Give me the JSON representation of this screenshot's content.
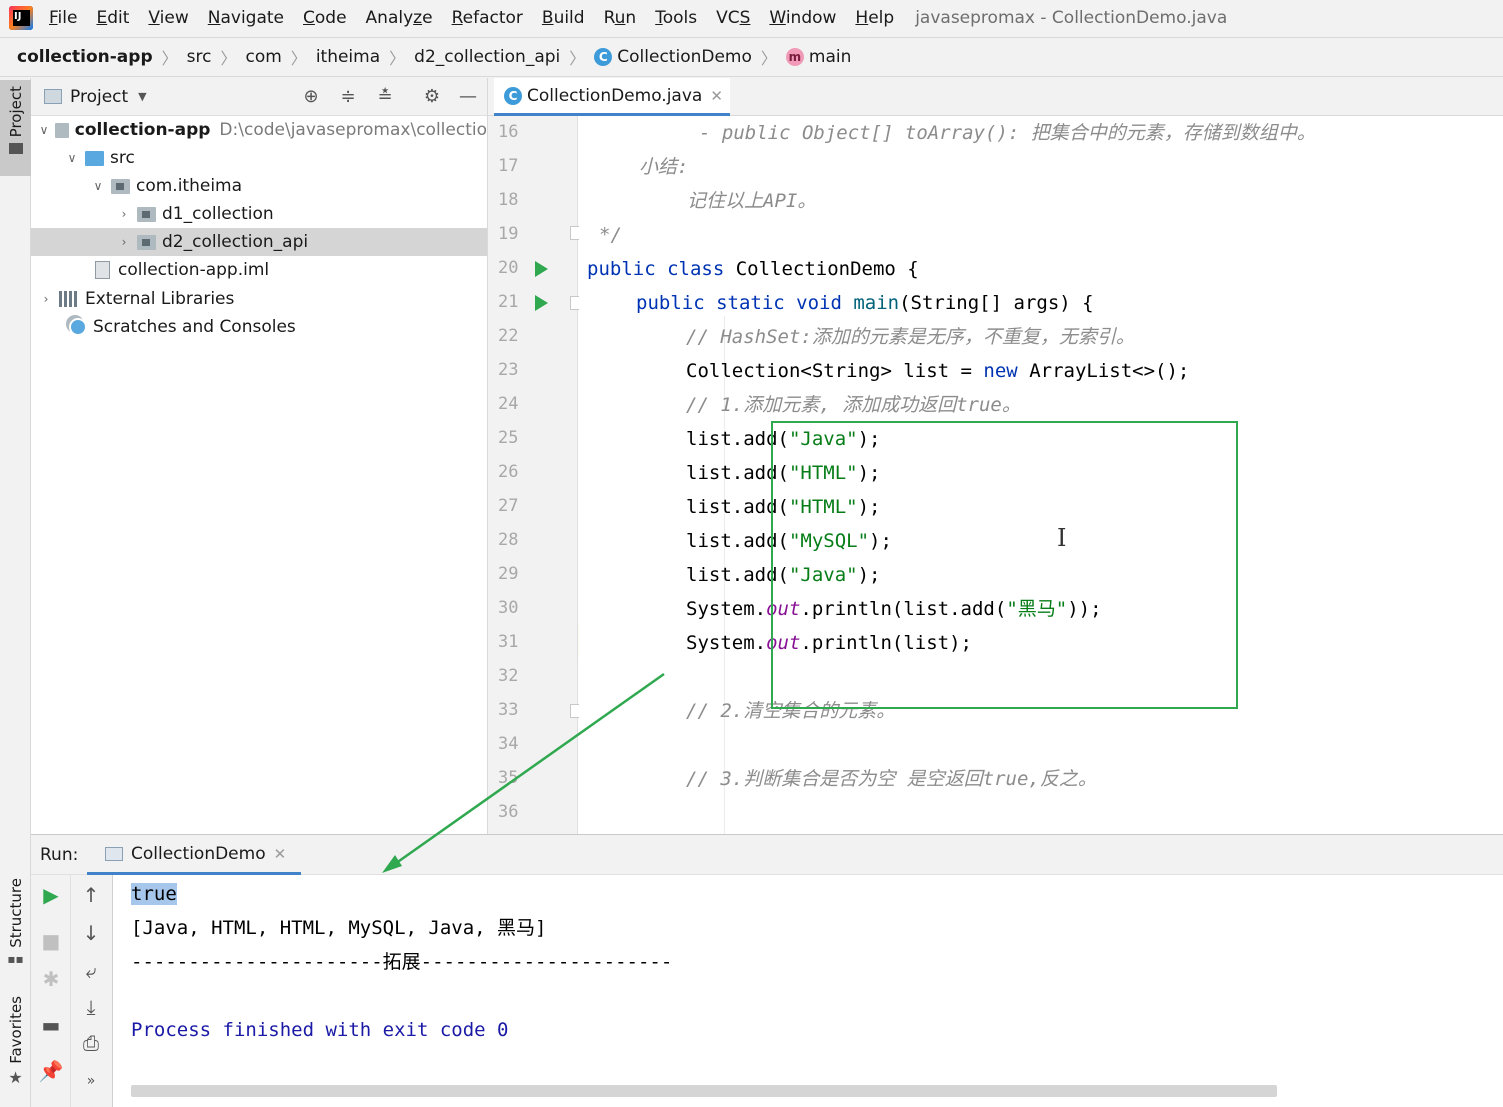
{
  "menubar": {
    "items": [
      {
        "pre": "",
        "u": "F",
        "post": "ile"
      },
      {
        "pre": "",
        "u": "E",
        "post": "dit"
      },
      {
        "pre": "",
        "u": "V",
        "post": "iew"
      },
      {
        "pre": "",
        "u": "N",
        "post": "avigate"
      },
      {
        "pre": "",
        "u": "C",
        "post": "ode"
      },
      {
        "pre": "Analy",
        "u": "z",
        "post": "e"
      },
      {
        "pre": "",
        "u": "R",
        "post": "efactor"
      },
      {
        "pre": "",
        "u": "B",
        "post": "uild"
      },
      {
        "pre": "R",
        "u": "u",
        "post": "n"
      },
      {
        "pre": "",
        "u": "T",
        "post": "ools"
      },
      {
        "pre": "VC",
        "u": "S",
        "post": ""
      },
      {
        "pre": "",
        "u": "W",
        "post": "indow"
      },
      {
        "pre": "",
        "u": "H",
        "post": "elp"
      }
    ],
    "window_title": "javasepromax - CollectionDemo.java"
  },
  "breadcrumb": [
    "collection-app",
    "src",
    "com",
    "itheima",
    "d2_collection_api",
    "CollectionDemo",
    "main"
  ],
  "left_strip": {
    "project": "Project",
    "structure": "Structure",
    "favorites": "Favorites"
  },
  "project": {
    "title": "Project",
    "tree": [
      {
        "label": "collection-app",
        "extra": "D:\\code\\javasepromax\\collectio"
      },
      {
        "label": "src"
      },
      {
        "label": "com.itheima"
      },
      {
        "label": "d1_collection"
      },
      {
        "label": "d2_collection_api"
      },
      {
        "label": "collection-app.iml"
      },
      {
        "label": "External Libraries"
      },
      {
        "label": "Scratches and Consoles"
      }
    ]
  },
  "editor": {
    "tab": "CollectionDemo.java",
    "line_numbers": [
      "16",
      "17",
      "18",
      "19",
      "20",
      "21",
      "22",
      "23",
      "24",
      "25",
      "26",
      "27",
      "28",
      "29",
      "30",
      "31",
      "32",
      "33",
      "34",
      "35",
      "36"
    ],
    "code": {
      "l16": "- public Object[] toArray(): 把集合中的元素，存储到数组中。",
      "l17": "小结:",
      "l18": "记住以上API。",
      "l19": "*/",
      "l20_kw1": "public class",
      "l20_rest": " CollectionDemo {",
      "l21_kw": "public static void",
      "l21_m": " main",
      "l21_rest": "(String[] args) {",
      "l22": "// HashSet:添加的元素是无序，不重复，无索引。",
      "l23_a": "Collection<String> list = ",
      "l23_kw": "new",
      "l23_b": " ArrayList<>();",
      "l24": "// 1.添加元素, 添加成功返回true。",
      "l25_a": "list.add(",
      "l25_s": "\"Java\"",
      "l26_s": "\"HTML\"",
      "l27_s": "\"HTML\"",
      "l28_s": "\"MySQL\"",
      "l29_s": "\"Java\"",
      "close": ");",
      "sys": "System.",
      "out": "out",
      "l30_a": ".println(list.add(",
      "l30_s": "\"黑马\"",
      "l30_b": "));",
      "l31_b": ".println(list);",
      "l33": "// 2.清空集合的元素。",
      "l35": "// 3.判断集合是否为空 是空返回true,反之。"
    }
  },
  "run": {
    "label": "Run:",
    "tab": "CollectionDemo",
    "output": {
      "line1": "true",
      "line2": "[Java, HTML, HTML, MySQL, Java, 黑马]",
      "line3": "----------------------拓展----------------------",
      "line4": "Process finished with exit code 0"
    }
  },
  "colors": {
    "accent": "#4083c9",
    "run_green": "#2fa84f",
    "annotation": "#2fa84f"
  }
}
